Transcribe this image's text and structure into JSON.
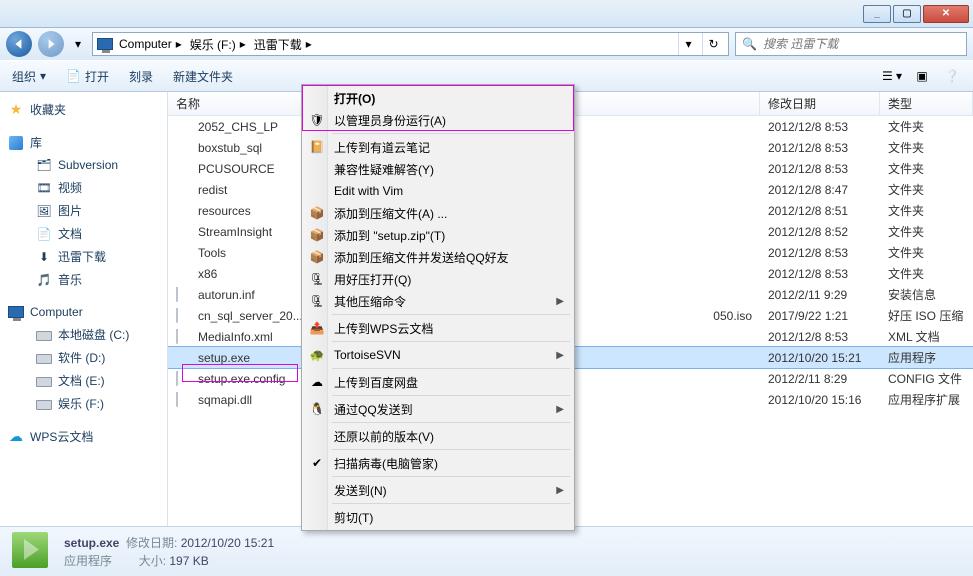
{
  "window": {
    "min": "_",
    "max": "▢",
    "close": "✕"
  },
  "breadcrumb": [
    "Computer",
    "娱乐 (F:)",
    "迅雷下载"
  ],
  "search": {
    "placeholder": "搜索 迅雷下载"
  },
  "toolbar": {
    "org": "组织",
    "open": "打开",
    "burn": "刻录",
    "newfolder": "新建文件夹"
  },
  "columns": {
    "name": "名称",
    "date": "修改日期",
    "type": "类型"
  },
  "nav": {
    "fav": "收藏夹",
    "lib": "库",
    "lib_items": [
      "Subversion",
      "视频",
      "图片",
      "文档",
      "迅雷下载",
      "音乐"
    ],
    "comp": "Computer",
    "drives": [
      "本地磁盘 (C:)",
      "软件 (D:)",
      "文档 (E:)",
      "娱乐 (F:)"
    ],
    "wps": "WPS云文档"
  },
  "files": [
    {
      "name": "2052_CHS_LP",
      "date": "2012/12/8 8:53",
      "type": "文件夹",
      "icon": "folder"
    },
    {
      "name": "boxstub_sql",
      "date": "2012/12/8 8:53",
      "type": "文件夹",
      "icon": "folder"
    },
    {
      "name": "PCUSOURCE",
      "date": "2012/12/8 8:53",
      "type": "文件夹",
      "icon": "folder"
    },
    {
      "name": "redist",
      "date": "2012/12/8 8:47",
      "type": "文件夹",
      "icon": "folder"
    },
    {
      "name": "resources",
      "date": "2012/12/8 8:51",
      "type": "文件夹",
      "icon": "folder"
    },
    {
      "name": "StreamInsight",
      "date": "2012/12/8 8:52",
      "type": "文件夹",
      "icon": "folder"
    },
    {
      "name": "Tools",
      "date": "2012/12/8 8:53",
      "type": "文件夹",
      "icon": "folder"
    },
    {
      "name": "x86",
      "date": "2012/12/8 8:53",
      "type": "文件夹",
      "icon": "folder"
    },
    {
      "name": "autorun.inf",
      "date": "2012/2/11 9:29",
      "type": "安装信息",
      "icon": "file"
    },
    {
      "name": "cn_sql_server_20...",
      "date_suffix": "050.iso",
      "date": "2017/9/22 1:21",
      "type": "好压 ISO 压缩",
      "icon": "file"
    },
    {
      "name": "MediaInfo.xml",
      "date": "2012/12/8 8:53",
      "type": "XML 文档",
      "icon": "file"
    },
    {
      "name": "setup.exe",
      "date": "2012/10/20 15:21",
      "type": "应用程序",
      "icon": "exe",
      "selected": true
    },
    {
      "name": "setup.exe.config",
      "date": "2012/2/11 8:29",
      "type": "CONFIG 文件",
      "icon": "file"
    },
    {
      "name": "sqmapi.dll",
      "date": "2012/10/20 15:16",
      "type": "应用程序扩展",
      "icon": "file"
    }
  ],
  "context": [
    {
      "t": "打开(O)",
      "bold": true
    },
    {
      "t": "以管理员身份运行(A)",
      "ico": "shield"
    },
    {
      "sep": true
    },
    {
      "t": "上传到有道云笔记",
      "ico": "ynote"
    },
    {
      "t": "兼容性疑难解答(Y)"
    },
    {
      "t": "Edit with Vim"
    },
    {
      "t": "添加到压缩文件(A) ...",
      "ico": "zip"
    },
    {
      "t": "添加到 \"setup.zip\"(T)",
      "ico": "zip"
    },
    {
      "t": "添加到压缩文件并发送给QQ好友",
      "ico": "zip"
    },
    {
      "t": "用好压打开(Q)",
      "ico": "zip2"
    },
    {
      "t": "其他压缩命令",
      "ico": "zip2",
      "sub": true
    },
    {
      "sep": true
    },
    {
      "t": "上传到WPS云文档",
      "ico": "wps"
    },
    {
      "sep": true
    },
    {
      "t": "TortoiseSVN",
      "ico": "svn",
      "sub": true
    },
    {
      "sep": true
    },
    {
      "t": "上传到百度网盘",
      "ico": "baidu"
    },
    {
      "sep": true
    },
    {
      "t": "通过QQ发送到",
      "ico": "qq",
      "sub": true
    },
    {
      "sep": true
    },
    {
      "t": "还原以前的版本(V)"
    },
    {
      "sep": true
    },
    {
      "t": "扫描病毒(电脑管家)",
      "ico": "av"
    },
    {
      "sep": true
    },
    {
      "t": "发送到(N)",
      "sub": true
    },
    {
      "sep": true
    },
    {
      "t": "剪切(T)"
    }
  ],
  "status": {
    "name": "setup.exe",
    "type_lbl": "应用程序",
    "date_lbl": "修改日期:",
    "date": "2012/10/20 15:21",
    "size_lbl": "大小:",
    "size": "197 KB"
  }
}
